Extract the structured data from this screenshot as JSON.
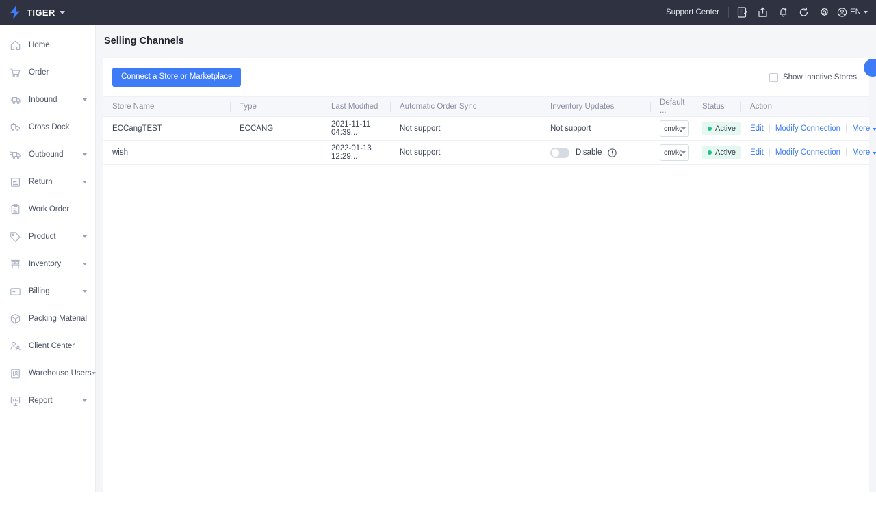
{
  "topbar": {
    "brand": "TIGER",
    "logo_icon": "lightning-bolt-icon",
    "brand_caret_icon": "chevron-down-icon",
    "support_center": "Support Center",
    "icons": [
      {
        "name": "document-edit-icon"
      },
      {
        "name": "share-export-icon"
      },
      {
        "name": "bell-notification-icon"
      },
      {
        "name": "refresh-icon"
      },
      {
        "name": "gear-settings-icon"
      }
    ],
    "user_icon": "user-avatar-icon",
    "language": "EN",
    "language_caret_icon": "chevron-down-icon"
  },
  "sidebar": {
    "items": [
      {
        "label": "Home",
        "icon": "home-icon",
        "expandable": false
      },
      {
        "label": "Order",
        "icon": "cart-icon",
        "expandable": false
      },
      {
        "label": "Inbound",
        "icon": "inbound-truck-icon",
        "expandable": true
      },
      {
        "label": "Cross Dock",
        "icon": "cross-dock-icon",
        "expandable": false
      },
      {
        "label": "Outbound",
        "icon": "outbound-truck-icon",
        "expandable": true
      },
      {
        "label": "Return",
        "icon": "return-box-icon",
        "expandable": true
      },
      {
        "label": "Work Order",
        "icon": "clipboard-icon",
        "expandable": false
      },
      {
        "label": "Product",
        "icon": "tag-icon",
        "expandable": true
      },
      {
        "label": "Inventory",
        "icon": "shelf-icon",
        "expandable": true
      },
      {
        "label": "Billing",
        "icon": "card-icon",
        "expandable": true
      },
      {
        "label": "Packing Material",
        "icon": "package-icon",
        "expandable": false
      },
      {
        "label": "Client Center",
        "icon": "people-icon",
        "expandable": false
      },
      {
        "label": "Warehouse Users",
        "icon": "user-list-icon",
        "expandable": true
      },
      {
        "label": "Report",
        "icon": "report-chart-icon",
        "expandable": true
      }
    ]
  },
  "page": {
    "title": "Selling Channels"
  },
  "toolbar": {
    "connect_button": "Connect a Store or Marketplace",
    "show_inactive_label": "Show Inactive Stores",
    "show_inactive_checked": false
  },
  "table": {
    "columns": [
      "Store Name",
      "Type",
      "Last Modified",
      "Automatic Order Sync",
      "Inventory Updates",
      "Default ...",
      "Status",
      "Action"
    ],
    "rows": [
      {
        "store_name": "ECCangTEST",
        "type": "ECCANG",
        "last_modified": "2021-11-11 04:39...",
        "order_sync": "Not support",
        "inventory_mode": "text",
        "inventory_text": "Not support",
        "toggle_on": false,
        "default_unit": "cm/kg",
        "status": "Active",
        "actions": {
          "edit": "Edit",
          "modify": "Modify Connection",
          "more": "More"
        }
      },
      {
        "store_name": "wish",
        "type": "",
        "last_modified": "2022-01-13 12:29...",
        "order_sync": "Not support",
        "inventory_mode": "toggle",
        "inventory_text": "Disable",
        "toggle_on": false,
        "default_unit": "cm/kg",
        "status": "Active",
        "actions": {
          "edit": "Edit",
          "modify": "Modify Connection",
          "more": "More"
        }
      }
    ]
  },
  "colors": {
    "topbar_bg": "#2e3241",
    "primary": "#3d7bf7",
    "status_green": "#1fc08a",
    "status_bg": "#e4f7f0"
  }
}
